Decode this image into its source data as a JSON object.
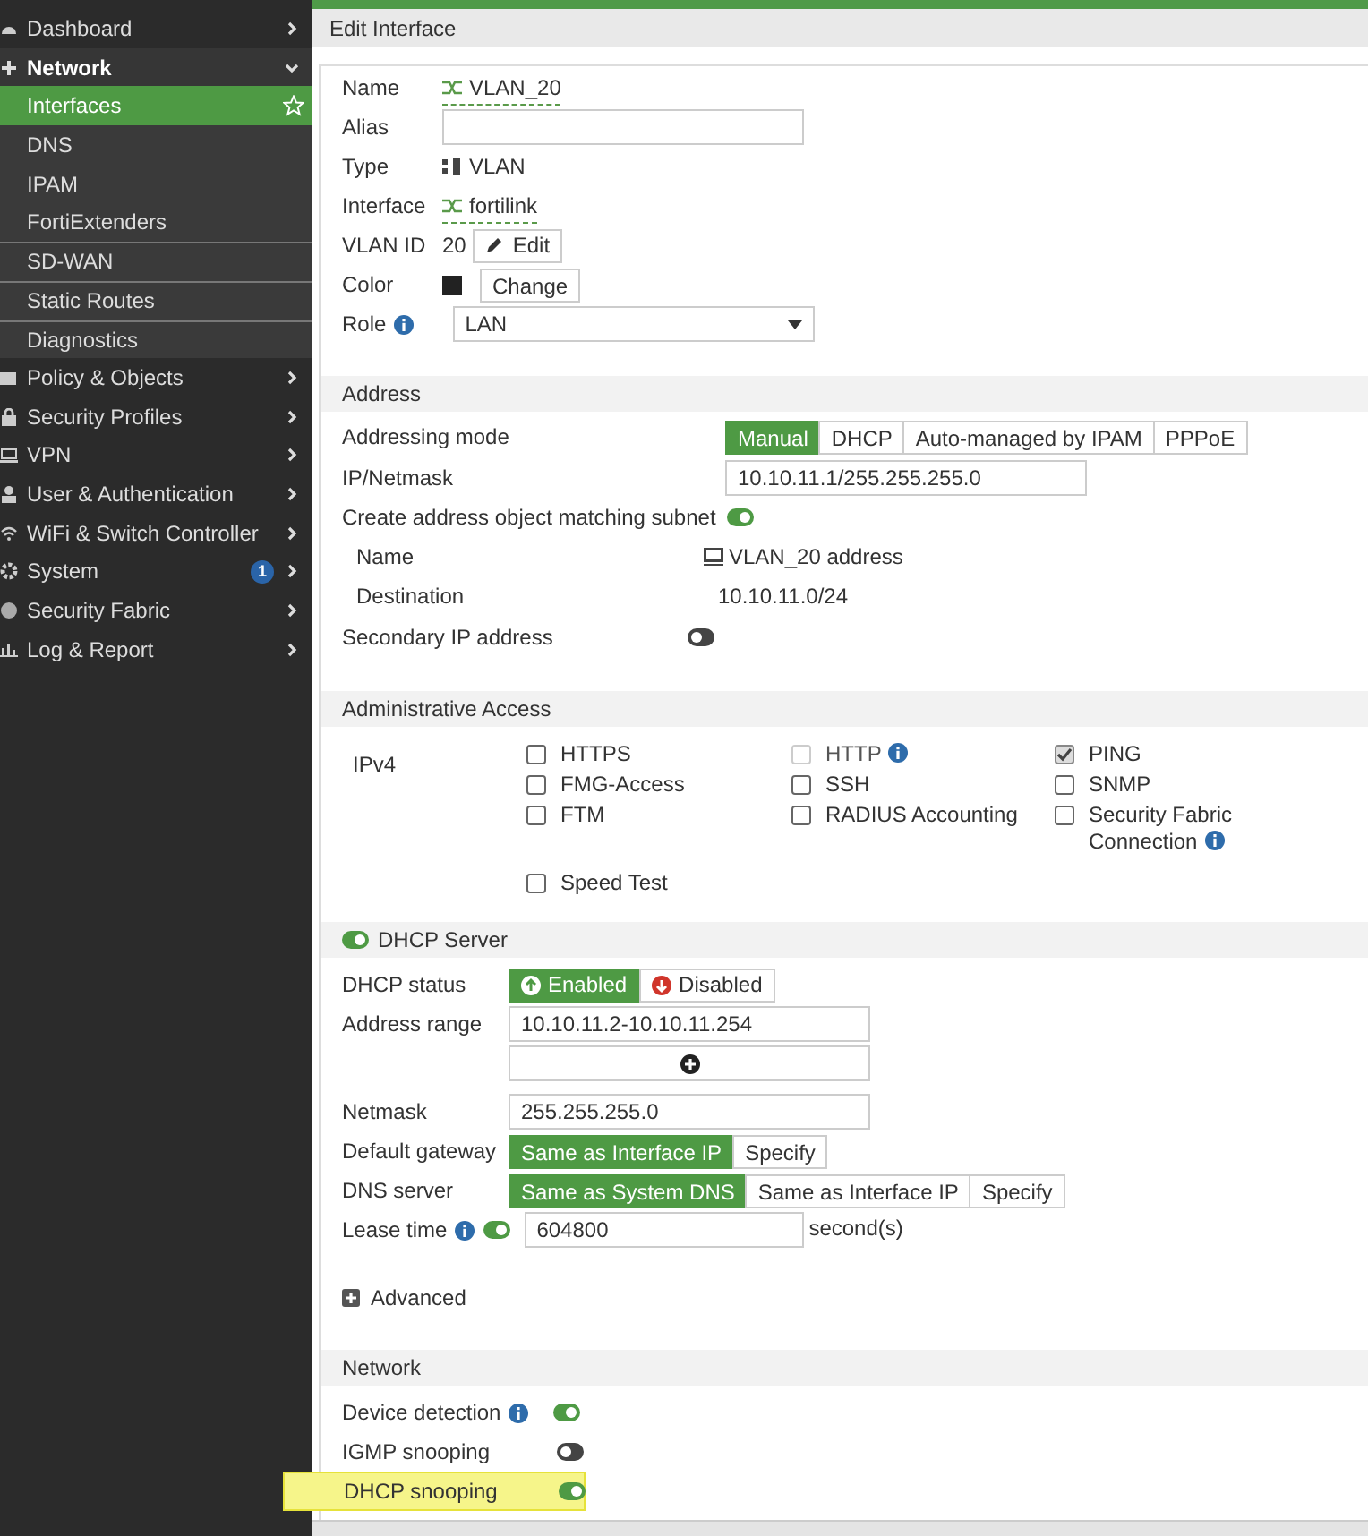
{
  "sidebar": {
    "items": [
      {
        "label": "Dashboard",
        "expanded": false
      },
      {
        "label": "Network",
        "expanded": true,
        "children": [
          {
            "label": "Interfaces",
            "selected": true
          },
          {
            "label": "DNS",
            "selected": false
          },
          {
            "label": "IPAM",
            "selected": false
          },
          {
            "label": "FortiExtenders",
            "selected": false
          },
          {
            "label": "SD-WAN",
            "selected": false
          },
          {
            "label": "Static Routes",
            "selected": false
          },
          {
            "label": "Diagnostics",
            "selected": false
          }
        ]
      },
      {
        "label": "Policy & Objects",
        "expanded": false
      },
      {
        "label": "Security Profiles",
        "expanded": false
      },
      {
        "label": "VPN",
        "expanded": false
      },
      {
        "label": "User & Authentication",
        "expanded": false
      },
      {
        "label": "WiFi & Switch Controller",
        "expanded": false
      },
      {
        "label": "System",
        "expanded": false,
        "badge": "1"
      },
      {
        "label": "Security Fabric",
        "expanded": false
      },
      {
        "label": "Log & Report",
        "expanded": false
      }
    ]
  },
  "page_title": "Edit Interface",
  "interface": {
    "name": {
      "label": "Name",
      "value": "VLAN_20"
    },
    "alias": {
      "label": "Alias"
    },
    "type": {
      "label": "Type",
      "value": "VLAN"
    },
    "interface": {
      "label": "Interface",
      "value": "fortilink"
    },
    "vlan_id": {
      "label": "VLAN ID",
      "value": "20",
      "button": "Edit"
    },
    "color": {
      "label": "Color",
      "button": "Change"
    },
    "role": {
      "label": "Role",
      "value": "LAN"
    }
  },
  "address": {
    "title": "Address",
    "addressing_mode": {
      "label": "Addressing mode",
      "options": [
        {
          "label": "Manual",
          "selected": true
        },
        {
          "label": "DHCP",
          "selected": false
        },
        {
          "label": "Auto-managed by IPAM",
          "selected": false
        },
        {
          "label": "PPPoE",
          "selected": false
        }
      ]
    },
    "ip_netmask": {
      "label": "IP/Netmask",
      "value": "10.10.11.1/255.255.255.0"
    },
    "create_object": {
      "label": "Create address object matching subnet",
      "on": true
    },
    "object_name": {
      "label": "Name",
      "value": "VLAN_20 address"
    },
    "destination": {
      "label": "Destination",
      "value": "10.10.11.0/24"
    },
    "secondary_ip": {
      "label": "Secondary IP address",
      "on": false
    }
  },
  "administrative_access": {
    "title": "Administrative Access",
    "protocol": "IPv4",
    "options": [
      {
        "label": "HTTPS",
        "checked": false,
        "disabled": false,
        "info": false
      },
      {
        "label": "HTTP",
        "checked": false,
        "disabled": true,
        "info": true
      },
      {
        "label": "PING",
        "checked": true,
        "disabled": false,
        "info": false
      },
      {
        "label": "FMG-Access",
        "checked": false,
        "disabled": false,
        "info": false
      },
      {
        "label": "SSH",
        "checked": false,
        "disabled": false,
        "info": false
      },
      {
        "label": "SNMP",
        "checked": false,
        "disabled": false,
        "info": false
      },
      {
        "label": "FTM",
        "checked": false,
        "disabled": false,
        "info": false
      },
      {
        "label": "RADIUS Accounting",
        "checked": false,
        "disabled": false,
        "info": false
      },
      {
        "label": "Security Fabric Connection",
        "checked": false,
        "disabled": false,
        "info": true
      },
      {
        "label": "Speed Test",
        "checked": false,
        "disabled": false,
        "info": false
      }
    ]
  },
  "dhcp_server": {
    "title": "DHCP Server",
    "on": true,
    "status": {
      "label": "DHCP status",
      "options": [
        {
          "label": "Enabled",
          "selected": true
        },
        {
          "label": "Disabled",
          "selected": false
        }
      ]
    },
    "address_range": {
      "label": "Address range",
      "value": "10.10.11.2-10.10.11.254"
    },
    "netmask": {
      "label": "Netmask",
      "value": "255.255.255.0"
    },
    "default_gateway": {
      "label": "Default gateway",
      "options": [
        {
          "label": "Same as Interface IP",
          "selected": true
        },
        {
          "label": "Specify",
          "selected": false
        }
      ]
    },
    "dns_server": {
      "label": "DNS server",
      "options": [
        {
          "label": "Same as System DNS",
          "selected": true
        },
        {
          "label": "Same as Interface IP",
          "selected": false
        },
        {
          "label": "Specify",
          "selected": false
        }
      ]
    },
    "lease_time": {
      "label": "Lease time",
      "on": true,
      "value": "604800",
      "unit": "second(s)"
    },
    "advanced": "Advanced"
  },
  "network": {
    "title": "Network",
    "options": [
      {
        "label": "Device detection",
        "info": true,
        "on": true,
        "highlighted": false
      },
      {
        "label": "IGMP snooping",
        "info": false,
        "on": false,
        "highlighted": false
      },
      {
        "label": "DHCP snooping",
        "info": false,
        "on": true,
        "highlighted": true
      }
    ]
  }
}
